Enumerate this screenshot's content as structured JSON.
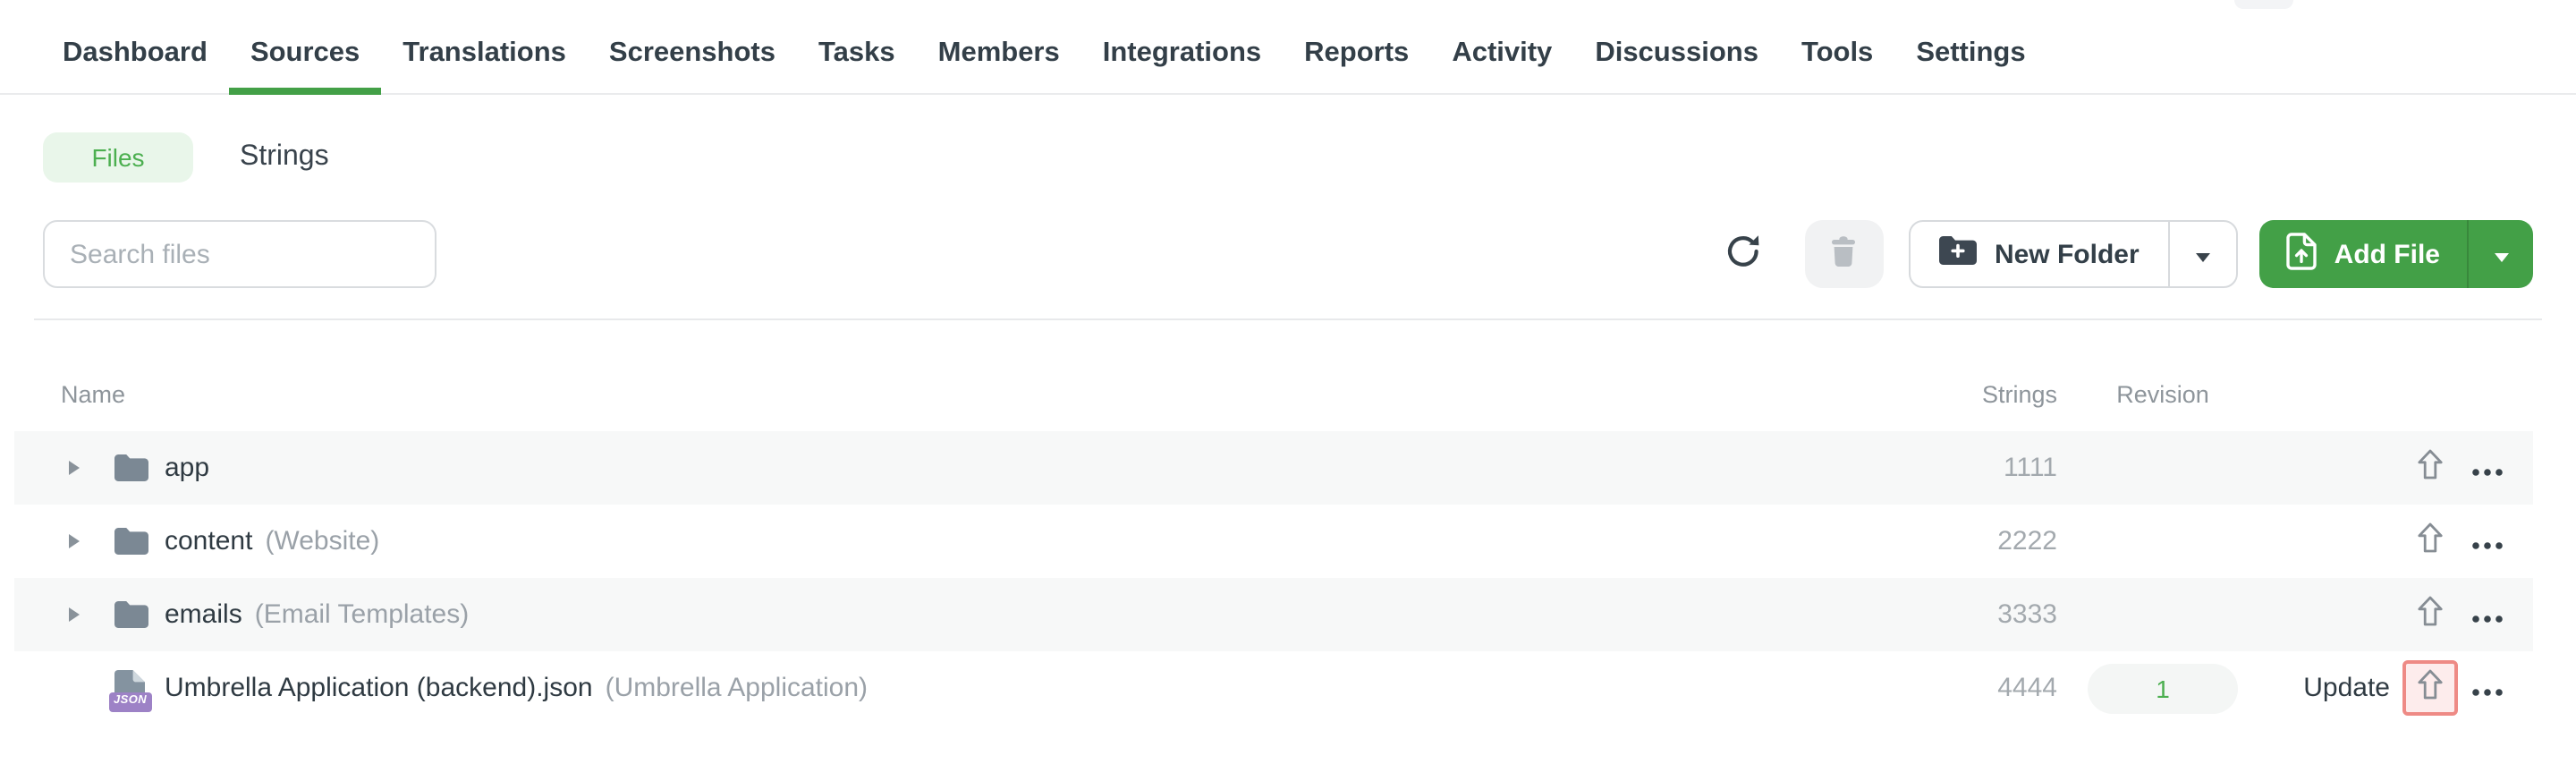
{
  "nav": {
    "items": [
      {
        "label": "Dashboard",
        "active": false
      },
      {
        "label": "Sources",
        "active": true
      },
      {
        "label": "Translations",
        "active": false
      },
      {
        "label": "Screenshots",
        "active": false
      },
      {
        "label": "Tasks",
        "active": false
      },
      {
        "label": "Members",
        "active": false
      },
      {
        "label": "Integrations",
        "active": false
      },
      {
        "label": "Reports",
        "active": false
      },
      {
        "label": "Activity",
        "active": false
      },
      {
        "label": "Discussions",
        "active": false
      },
      {
        "label": "Tools",
        "active": false
      },
      {
        "label": "Settings",
        "active": false
      }
    ]
  },
  "tabs": {
    "files_label": "Files",
    "strings_label": "Strings",
    "active": "Files"
  },
  "toolbar": {
    "search_placeholder": "Search files",
    "new_folder_label": "New Folder",
    "add_file_label": "Add File"
  },
  "table": {
    "headers": {
      "name": "Name",
      "strings": "Strings",
      "revision": "Revision"
    },
    "rows": [
      {
        "type": "folder",
        "name": "app",
        "subtitle": "",
        "strings": "1111",
        "revision": "",
        "update_label": "",
        "upload_highlighted": false
      },
      {
        "type": "folder",
        "name": "content",
        "subtitle": "(Website)",
        "strings": "2222",
        "revision": "",
        "update_label": "",
        "upload_highlighted": false
      },
      {
        "type": "folder",
        "name": "emails",
        "subtitle": "(Email Templates)",
        "strings": "3333",
        "revision": "",
        "update_label": "",
        "upload_highlighted": false
      },
      {
        "type": "file",
        "badge": "JSON",
        "name": "Umbrella Application (backend).json",
        "subtitle": "(Umbrella Application)",
        "strings": "4444",
        "revision": "1",
        "update_label": "Update",
        "upload_highlighted": true
      }
    ]
  },
  "colors": {
    "accent_green": "#43a047",
    "files_tab_bg": "#e9f6ea",
    "files_tab_text": "#4caf50",
    "revision_green": "#4caf50",
    "highlight_border": "#ee8a85",
    "highlight_bg": "#fdecec",
    "json_badge_purple": "#9d82c6"
  }
}
